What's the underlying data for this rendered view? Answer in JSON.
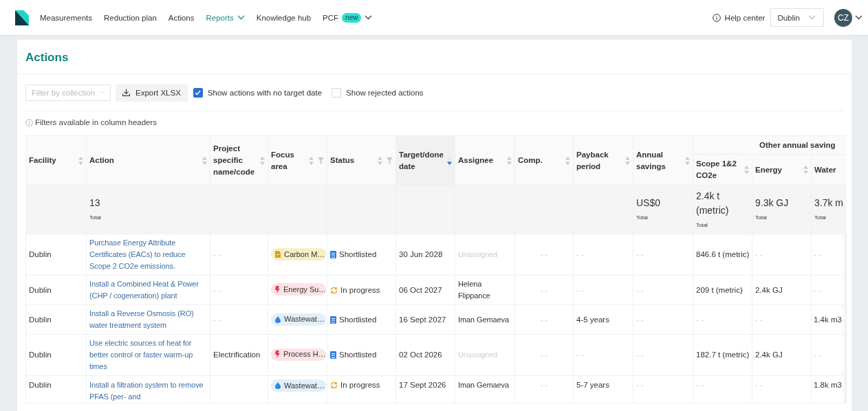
{
  "nav": {
    "items": [
      {
        "label": "Measurements",
        "selected": false
      },
      {
        "label": "Reduction plan",
        "selected": false
      },
      {
        "label": "Actions",
        "selected": false
      },
      {
        "label": "Reports",
        "selected": true,
        "kind": "dropdown"
      },
      {
        "label": "Knowledge hub",
        "selected": false
      },
      {
        "label": "PCF",
        "selected": false,
        "kind": "dropdown",
        "badge": "new"
      }
    ],
    "help_center": "Help center",
    "facility_select": "Dublin",
    "avatar": "CZ"
  },
  "page": {
    "title": "Actions",
    "toolbar": {
      "filter_placeholder": "Filter by collection",
      "export_button": "Export XLSX",
      "checkboxes": [
        {
          "label": "Show actions with no target date",
          "checked": true
        },
        {
          "label": "Show rejected actions",
          "checked": false
        }
      ]
    },
    "info": "Filters available in column headers"
  },
  "table": {
    "group_header": "Other annual saving",
    "columns": [
      {
        "label": "Facility",
        "sortable": true,
        "sorted_descending": false
      },
      {
        "label": "Action",
        "sortable": true,
        "sorted_descending": false,
        "total": {
          "value": "13",
          "label": "Total"
        }
      },
      {
        "label": "Project specific name/code",
        "sortable": true,
        "sorted_descending": false
      },
      {
        "label": "Focus area",
        "sortable": true,
        "sorted_descending": false,
        "filter": true
      },
      {
        "label": "Status",
        "sortable": true,
        "sorted_descending": false,
        "filter": true
      },
      {
        "label": "Target/done date",
        "sortable": true,
        "sorted_descending": true
      },
      {
        "label": "Assignee",
        "sortable": true,
        "sorted_descending": false
      },
      {
        "label": "Comp.",
        "sortable": true,
        "sorted_descending": false
      },
      {
        "label": "Payback period",
        "sortable": true,
        "sorted_descending": false
      },
      {
        "label": "Annual savings",
        "sortable": true,
        "sorted_descending": false,
        "total": {
          "value": "US$0",
          "label": "Total"
        }
      },
      {
        "label": "Scope 1&2 CO2e",
        "sortable": true,
        "sorted_descending": false,
        "grouped": true,
        "total": {
          "value": "2.4k t (metric)",
          "label": "Total"
        }
      },
      {
        "label": "Energy",
        "sortable": true,
        "sorted_descending": false,
        "grouped": true,
        "total": {
          "value": "9.3k GJ",
          "label": "Total"
        }
      },
      {
        "label": "Water",
        "grouped": true,
        "total": {
          "value": "3.7k m",
          "label": "Total"
        }
      }
    ],
    "rows": [
      {
        "cells": [
          "Dublin",
          {
            "kind": "link",
            "text": "Purchase Energy Attribute Certificates (EACs) to reduce Scope 2 CO2e emissions."
          },
          {
            "kind": "muted",
            "text": "- -"
          },
          {
            "kind": "chip",
            "tag": {
              "kind": "carbon",
              "text": "Carbon M…"
            }
          },
          {
            "kind": "status",
            "status": {
              "kind": "shortlisted",
              "text": "Shortlisted"
            }
          },
          "30 Jun 2028",
          {
            "kind": "muted",
            "text": "Unassigned"
          },
          {
            "kind": "muted",
            "text": "- -"
          },
          {
            "kind": "muted",
            "text": "- -"
          },
          {
            "kind": "muted",
            "text": "- -"
          },
          "846.6 t (metric)",
          {
            "kind": "muted",
            "text": "- -"
          },
          {
            "kind": "muted",
            "text": "- -"
          }
        ]
      },
      {
        "cells": [
          "Dublin",
          {
            "kind": "link",
            "text": "Install a Combined Heat & Power (CHP / cogeneration) plant"
          },
          {
            "kind": "muted",
            "text": "- -"
          },
          {
            "kind": "chip",
            "tag": {
              "kind": "energy",
              "text": "Energy Su…"
            }
          },
          {
            "kind": "status",
            "status": {
              "kind": "in_progress",
              "text": "In progress"
            }
          },
          "06 Oct 2027",
          "Helena Flippance",
          {
            "kind": "muted",
            "text": "- -"
          },
          {
            "kind": "muted",
            "text": "- -"
          },
          {
            "kind": "muted",
            "text": "- -"
          },
          "209 t (metric)",
          "2.4k GJ",
          {
            "kind": "muted",
            "text": "- -"
          }
        ]
      },
      {
        "cells": [
          "Dublin",
          {
            "kind": "link",
            "text": "Install a Reverse Osmosis (RO) water treatment system"
          },
          {
            "kind": "muted",
            "text": "- -"
          },
          {
            "kind": "chip",
            "tag": {
              "kind": "water",
              "text": "Wastewat…"
            }
          },
          {
            "kind": "status",
            "status": {
              "kind": "shortlisted",
              "text": "Shortlisted"
            }
          },
          "16 Sept 2027",
          "Iman Gemaeva",
          {
            "kind": "muted",
            "text": "- -"
          },
          "4-5 years",
          {
            "kind": "muted",
            "text": "- -"
          },
          {
            "kind": "muted",
            "text": "- -"
          },
          {
            "kind": "muted",
            "text": "- -"
          },
          "1.4k m3"
        ]
      },
      {
        "cells": [
          "Dublin",
          {
            "kind": "link",
            "text": "Use electric sources of heat for better control or faster warm-up times"
          },
          "Electrification",
          {
            "kind": "chip",
            "tag": {
              "kind": "energy",
              "text": "Process H…"
            }
          },
          {
            "kind": "status",
            "status": {
              "kind": "shortlisted",
              "text": "Shortlisted"
            }
          },
          "02 Oct 2026",
          {
            "kind": "muted",
            "text": "Unassigned"
          },
          {
            "kind": "muted",
            "text": "- -"
          },
          {
            "kind": "muted",
            "text": "- -"
          },
          {
            "kind": "muted",
            "text": "- -"
          },
          "182.7 t (metric)",
          "2.4k GJ",
          {
            "kind": "muted",
            "text": "- -"
          }
        ]
      },
      {
        "cells": [
          "Dublin",
          {
            "kind": "link",
            "text": "Install a filtration system to remove PFAS (per- and"
          },
          null,
          {
            "kind": "chip",
            "tag": {
              "kind": "water",
              "text": "Wastewat…"
            }
          },
          {
            "kind": "status",
            "status": {
              "kind": "in_progress",
              "text": "In progress"
            }
          },
          "17 Sept 2026",
          "Iman Gemaeva",
          {
            "kind": "muted",
            "text": "- -"
          },
          "5-7 years",
          {
            "kind": "muted",
            "text": "- -"
          },
          {
            "kind": "muted",
            "text": "- -"
          },
          {
            "kind": "muted",
            "text": "- -"
          },
          "1.8k m3"
        ]
      }
    ]
  }
}
